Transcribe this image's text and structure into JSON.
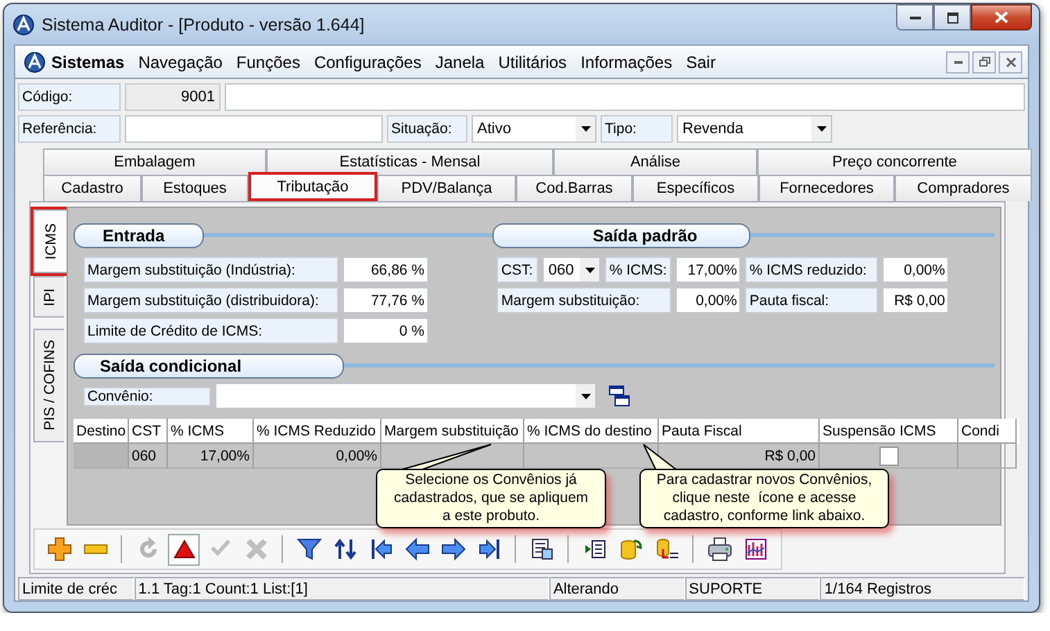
{
  "window": {
    "title": "Sistema Auditor - [Produto - versão 1.644]"
  },
  "menu": {
    "app": "Sistemas",
    "items": [
      "Navegação",
      "Funções",
      "Configurações",
      "Janela",
      "Utilitários",
      "Informações",
      "Sair"
    ]
  },
  "header": {
    "codigo": {
      "label": "Código:",
      "value": "9001"
    },
    "referencia": {
      "label": "Referência:"
    },
    "situacao": {
      "label": "Situação:",
      "value": "Ativo"
    },
    "tipo": {
      "label": "Tipo:",
      "value": "Revenda"
    }
  },
  "tabs_top": [
    {
      "label": "Embalagem",
      "selected": false
    },
    {
      "label": "Estatísticas - Mensal",
      "selected": false
    },
    {
      "label": "Análise",
      "selected": false
    },
    {
      "label": "Preço concorrente",
      "selected": false
    }
  ],
  "tabs": [
    {
      "label": "Cadastro",
      "selected": false,
      "highlighted": false
    },
    {
      "label": "Estoques",
      "selected": false,
      "highlighted": false
    },
    {
      "label": "Tributação",
      "selected": true,
      "highlighted": true
    },
    {
      "label": "PDV/Balança",
      "selected": false,
      "highlighted": false
    },
    {
      "label": "Cod.Barras",
      "selected": false,
      "highlighted": false
    },
    {
      "label": "Específicos",
      "selected": false,
      "highlighted": false
    },
    {
      "label": "Fornecedores",
      "selected": false,
      "highlighted": false
    },
    {
      "label": "Compradores",
      "selected": false,
      "highlighted": false
    }
  ],
  "side_tabs": [
    {
      "label": "ICMS",
      "selected": true,
      "highlighted": true
    },
    {
      "label": "IPI",
      "selected": false,
      "highlighted": false
    },
    {
      "label": "PIS / COFINS",
      "selected": false,
      "highlighted": false
    }
  ],
  "entrada": {
    "title": "Entrada",
    "rows": [
      {
        "label": "Margem substituição (Indústria):",
        "value": "66,86 %"
      },
      {
        "label": "Margem substituição (distribuidora):",
        "value": "77,76 %"
      },
      {
        "label": "Limite de Crédito de ICMS:",
        "value": "0 %"
      }
    ]
  },
  "saida_padrao": {
    "title": "Saída padrão",
    "cst": {
      "label": "CST:",
      "value": "060"
    },
    "icms": {
      "label": "% ICMS:",
      "value": "17,00%"
    },
    "icms_reduzido": {
      "label": "% ICMS reduzido:",
      "value": "0,00%"
    },
    "margem": {
      "label": "Margem substituição:",
      "value": "0,00%"
    },
    "pauta": {
      "label": "Pauta fiscal:",
      "value": "R$ 0,00"
    }
  },
  "saida_condicional": {
    "title": "Saída condicional",
    "convenio": {
      "label": "Convênio:"
    },
    "table": {
      "columns": [
        "Destino",
        "CST",
        "% ICMS",
        "% ICMS Reduzido",
        "Margem substituição",
        "% ICMS do destino",
        "Pauta Fiscal",
        "Suspensão ICMS",
        "Condi"
      ],
      "rows": [
        {
          "cst": "060",
          "icms": "17,00%",
          "icms_reduzido": "0,00%",
          "pauta_fiscal": "R$ 0,00",
          "suspensao_icms": false
        }
      ]
    }
  },
  "callouts": [
    {
      "text": "Selecione os Convênios já\ncadastrados, que se apliquem\na este probuto."
    },
    {
      "text": "Para cadastrar novos Convênios,\nclique neste  ícone e acesse\ncadastro, conforme link abaixo."
    }
  ],
  "toolbar": [
    [
      {
        "kind": "add",
        "disabled": false,
        "pressed": false
      },
      {
        "kind": "remove",
        "disabled": false,
        "pressed": false
      }
    ],
    [
      {
        "kind": "refresh",
        "disabled": true,
        "pressed": false
      },
      {
        "kind": "alert",
        "disabled": false,
        "pressed": true
      },
      {
        "kind": "confirm",
        "disabled": true,
        "pressed": false
      },
      {
        "kind": "cancel",
        "disabled": true,
        "pressed": false
      }
    ],
    [
      {
        "kind": "filter",
        "disabled": false,
        "pressed": false
      },
      {
        "kind": "sort",
        "disabled": false,
        "pressed": false
      },
      {
        "kind": "first",
        "disabled": false,
        "pressed": false
      },
      {
        "kind": "prev",
        "disabled": false,
        "pressed": false
      },
      {
        "kind": "next",
        "disabled": false,
        "pressed": false
      },
      {
        "kind": "last",
        "disabled": false,
        "pressed": false
      }
    ],
    [
      {
        "kind": "form",
        "disabled": false,
        "pressed": false
      }
    ],
    [
      {
        "kind": "import",
        "disabled": false,
        "pressed": false
      },
      {
        "kind": "export",
        "disabled": false,
        "pressed": false
      },
      {
        "kind": "database",
        "disabled": false,
        "pressed": false
      }
    ],
    [
      {
        "kind": "print",
        "disabled": false,
        "pressed": false
      },
      {
        "kind": "chart",
        "disabled": false,
        "pressed": false
      }
    ]
  ],
  "status_bar": [
    "Limite de créc",
    "1.1 Tag:1 Count:1 List:[1]",
    "Alterando",
    "SUPORTE",
    "1/164 Registros"
  ]
}
